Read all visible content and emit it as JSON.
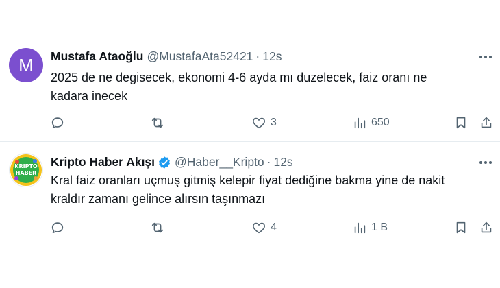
{
  "tweets": [
    {
      "avatar_letter": "M",
      "avatar_color": "#7b4fcf",
      "name": "Mustafa Ataoğlu",
      "handle": "@MustafaAta52421",
      "separator": "·",
      "time": "12s",
      "text_line1": "2025 de ne degisecek, ekonomi 4-6 ayda mı duzelecek, faiz oranı ne",
      "text_line2": "kadara inecek",
      "likes": "3",
      "views": "650",
      "icons": [
        "more-icon",
        "reply-icon",
        "retweet-icon",
        "like-icon",
        "views-icon",
        "bookmark-icon",
        "share-icon"
      ]
    },
    {
      "avatar_text": "KRIPTO HABER",
      "name": "Kripto Haber Akışı",
      "handle": "@Haber__Kripto",
      "separator": "·",
      "time": "12s",
      "verified_color": "#1d9bf0",
      "text_line1": "Kral faiz oranları uçmuş gitmiş kelepir fiyat dediğine bakma yine de nakit",
      "text_line2": "kraldır zamanı gelince alırsın taşınmazı",
      "likes": "4",
      "views": "1 B",
      "icons": [
        "verified-badge-icon",
        "more-icon",
        "reply-icon",
        "retweet-icon",
        "like-icon",
        "views-icon",
        "bookmark-icon",
        "share-icon"
      ]
    }
  ]
}
